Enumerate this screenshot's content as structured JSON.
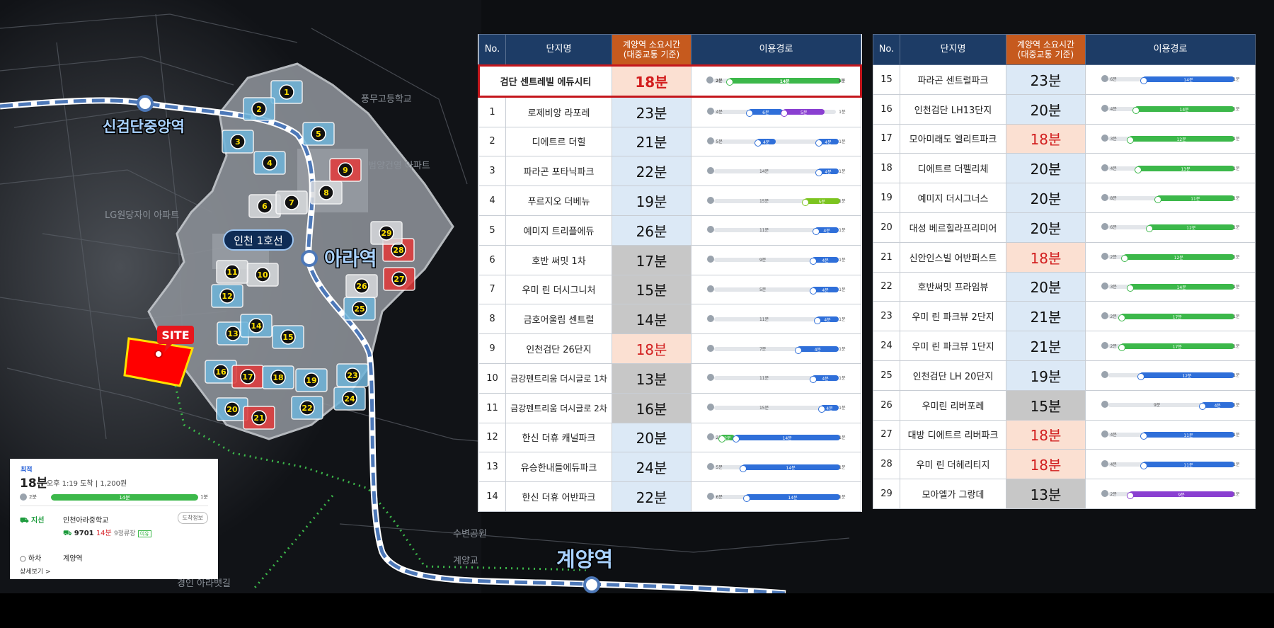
{
  "map": {
    "station_labels": {
      "sin_geomdan": "신검단중앙역",
      "ara": "아라역",
      "gyeyang": "계양역"
    },
    "line_label": "인천 1호선",
    "site_label": "SITE",
    "bg_labels": [
      "LG원당자이 아파트",
      "풍무고등학교",
      "범양건영 아파트",
      "수변공원",
      "계양교",
      "경인 아라뱃길"
    ],
    "markers": [
      {
        "n": "1",
        "c": "blue"
      },
      {
        "n": "2",
        "c": "blue"
      },
      {
        "n": "3",
        "c": "blue"
      },
      {
        "n": "4",
        "c": "blue"
      },
      {
        "n": "5",
        "c": "blue"
      },
      {
        "n": "6",
        "c": "gray"
      },
      {
        "n": "7",
        "c": "gray"
      },
      {
        "n": "8",
        "c": "gray"
      },
      {
        "n": "9",
        "c": "red"
      },
      {
        "n": "10",
        "c": "gray"
      },
      {
        "n": "11",
        "c": "gray"
      },
      {
        "n": "12",
        "c": "blue"
      },
      {
        "n": "13",
        "c": "blue"
      },
      {
        "n": "14",
        "c": "blue"
      },
      {
        "n": "15",
        "c": "blue"
      },
      {
        "n": "16",
        "c": "blue"
      },
      {
        "n": "17",
        "c": "red"
      },
      {
        "n": "18",
        "c": "blue"
      },
      {
        "n": "19",
        "c": "blue"
      },
      {
        "n": "20",
        "c": "blue"
      },
      {
        "n": "21",
        "c": "red"
      },
      {
        "n": "22",
        "c": "blue"
      },
      {
        "n": "23",
        "c": "blue"
      },
      {
        "n": "24",
        "c": "blue"
      },
      {
        "n": "25",
        "c": "blue"
      },
      {
        "n": "26",
        "c": "gray"
      },
      {
        "n": "27",
        "c": "red"
      },
      {
        "n": "28",
        "c": "red"
      },
      {
        "n": "29",
        "c": "gray"
      }
    ]
  },
  "info_card": {
    "label": "최적",
    "time": "18분",
    "arrival": "오후 1:19 도착  |  1,200원",
    "walk_start": "2분",
    "bus_minutes": "14분",
    "walk_end": "1분",
    "board_label": "⛟ 지선",
    "board_stop": "인천아라중학교",
    "button": "도착정보",
    "bus_no": "9701",
    "bus_time": "14분",
    "bus_stops": "9정류장",
    "bus_tag": "여유",
    "alight_label": "○ 하차",
    "alight_stop": "계양역",
    "more": "상세보기 >"
  },
  "headers": {
    "no": "No.",
    "name": "단지명",
    "time": "계양역 소요시간\n(대중교통 기준)",
    "route": "이용경로"
  },
  "colors": {
    "green": "#3cb84a",
    "blue": "#2f6fd9",
    "purple": "#8a3fd1",
    "lime": "#7cc41f",
    "walk": "#9aa3ad"
  },
  "table_left": [
    {
      "no": "",
      "name": "검단 센트레빌 에듀시티",
      "time": "18분",
      "bg": "peach",
      "featured": true,
      "route": {
        "walk": "2분",
        "segs": [
          {
            "c": "green",
            "s": 0.16,
            "e": 0.97,
            "l": "14분"
          }
        ],
        "end": "1분"
      }
    },
    {
      "no": "1",
      "name": "로제비앙 라포레",
      "time": "23분",
      "bg": "blue",
      "route": {
        "walk": "4분",
        "segs": [
          {
            "c": "blue",
            "s": 0.3,
            "e": 0.55,
            "l": "6분"
          },
          {
            "c": "purple",
            "s": 0.55,
            "e": 0.85,
            "l": "5분"
          }
        ],
        "end": "1분"
      }
    },
    {
      "no": "2",
      "name": "디에트르 더힐",
      "time": "21분",
      "bg": "blue",
      "route": {
        "walk": "5분",
        "segs": [
          {
            "c": "blue",
            "s": 0.36,
            "e": 0.5,
            "l": "4분"
          },
          {
            "c": "blue",
            "s": 0.8,
            "e": 0.95,
            "l": "4분"
          }
        ],
        "end": "1분",
        "mid": "4분"
      }
    },
    {
      "no": "3",
      "name": "파라곤 포타닉파크",
      "time": "22분",
      "bg": "blue",
      "route": {
        "walk": "",
        "segs": [
          {
            "c": "blue",
            "s": 0.8,
            "e": 0.95,
            "l": "4분"
          }
        ],
        "end": "1분",
        "mid": "14분"
      }
    },
    {
      "no": "4",
      "name": "푸르지오 더베뉴",
      "time": "19분",
      "bg": "blue",
      "route": {
        "walk": "",
        "segs": [
          {
            "c": "lime",
            "s": 0.7,
            "e": 0.96,
            "l": "5분"
          }
        ],
        "end": "1분",
        "mid": "15분"
      }
    },
    {
      "no": "5",
      "name": "예미지 트리플에듀",
      "time": "26분",
      "bg": "blue",
      "route": {
        "walk": "",
        "segs": [
          {
            "c": "blue",
            "s": 0.78,
            "e": 0.95,
            "l": "4분"
          }
        ],
        "end": "1분",
        "mid": "11분"
      }
    },
    {
      "no": "6",
      "name": "호반 써밋 1차",
      "time": "17분",
      "bg": "gray",
      "route": {
        "walk": "",
        "segs": [
          {
            "c": "blue",
            "s": 0.76,
            "e": 0.95,
            "l": "4분"
          }
        ],
        "end": "1분",
        "mid": "9분"
      }
    },
    {
      "no": "7",
      "name": "우미 린 더시그니처",
      "time": "15분",
      "bg": "gray",
      "route": {
        "walk": "",
        "segs": [
          {
            "c": "blue",
            "s": 0.76,
            "e": 0.95,
            "l": "4분"
          }
        ],
        "end": "1분",
        "mid": "5분"
      }
    },
    {
      "no": "8",
      "name": "금호어울림 센트럴",
      "time": "14분",
      "bg": "gray",
      "route": {
        "walk": "",
        "segs": [
          {
            "c": "blue",
            "s": 0.79,
            "e": 0.95,
            "l": "4분"
          }
        ],
        "end": "1분",
        "mid": "11분"
      }
    },
    {
      "no": "9",
      "name": "인천검단 26단지",
      "time": "18분",
      "bg": "peach",
      "route": {
        "walk": "",
        "segs": [
          {
            "c": "blue",
            "s": 0.65,
            "e": 0.95,
            "l": "4분"
          }
        ],
        "end": "1분",
        "mid": "7분"
      }
    },
    {
      "no": "10",
      "name": "금강펜트리움 더시글로 1차",
      "time": "13분",
      "bg": "gray",
      "route": {
        "walk": "",
        "segs": [
          {
            "c": "blue",
            "s": 0.76,
            "e": 0.95,
            "l": "4분"
          }
        ],
        "end": "1분",
        "mid": "11분"
      }
    },
    {
      "no": "11",
      "name": "금강펜트리움 더시글로 2차",
      "time": "16분",
      "bg": "gray",
      "route": {
        "walk": "",
        "segs": [
          {
            "c": "blue",
            "s": 0.82,
            "e": 0.95,
            "l": "4분"
          }
        ],
        "end": "1분",
        "mid": "15분"
      }
    },
    {
      "no": "12",
      "name": "한신 더휴 캐널파크",
      "time": "20분",
      "bg": "blue",
      "route": {
        "walk": "2분",
        "segs": [
          {
            "c": "green",
            "s": 0.1,
            "e": 0.2,
            "l": "2분"
          },
          {
            "c": "blue",
            "s": 0.2,
            "e": 0.96,
            "l": "14분"
          }
        ],
        "end": "1분"
      }
    },
    {
      "no": "13",
      "name": "유승한내들에듀파크",
      "time": "24분",
      "bg": "blue",
      "route": {
        "walk": "5분",
        "segs": [
          {
            "c": "blue",
            "s": 0.25,
            "e": 0.96,
            "l": "14분"
          }
        ],
        "end": "1분"
      }
    },
    {
      "no": "14",
      "name": "한신 더휴 어반파크",
      "time": "22분",
      "bg": "blue",
      "route": {
        "walk": "6분",
        "segs": [
          {
            "c": "blue",
            "s": 0.28,
            "e": 0.96,
            "l": "14분"
          }
        ],
        "end": "1분"
      }
    }
  ],
  "table_right": [
    {
      "no": "15",
      "name": "파라곤 센트럴파크",
      "time": "23분",
      "bg": "blue",
      "route": {
        "walk": "6분",
        "segs": [
          {
            "c": "blue",
            "s": 0.3,
            "e": 0.96,
            "l": "14분"
          }
        ],
        "end": "1분"
      }
    },
    {
      "no": "16",
      "name": "인천검단 LH13단지",
      "time": "20분",
      "bg": "blue",
      "route": {
        "walk": "4분",
        "segs": [
          {
            "c": "green",
            "s": 0.24,
            "e": 0.96,
            "l": "14분"
          }
        ],
        "end": "1분"
      }
    },
    {
      "no": "17",
      "name": "모아미래도 엘리트파크",
      "time": "18분",
      "bg": "peach",
      "route": {
        "walk": "3분",
        "segs": [
          {
            "c": "green",
            "s": 0.2,
            "e": 0.96,
            "l": "12분"
          }
        ],
        "end": "1분"
      }
    },
    {
      "no": "18",
      "name": "디에트르 더펠리체",
      "time": "20분",
      "bg": "blue",
      "route": {
        "walk": "4분",
        "segs": [
          {
            "c": "green",
            "s": 0.26,
            "e": 0.96,
            "l": "13분"
          }
        ],
        "end": "1분"
      }
    },
    {
      "no": "19",
      "name": "예미지 더시그너스",
      "time": "20분",
      "bg": "blue",
      "route": {
        "walk": "8분",
        "segs": [
          {
            "c": "green",
            "s": 0.4,
            "e": 0.96,
            "l": "11분"
          }
        ],
        "end": "1분"
      }
    },
    {
      "no": "20",
      "name": "대성 베르힐라프리미어",
      "time": "20분",
      "bg": "blue",
      "route": {
        "walk": "6분",
        "segs": [
          {
            "c": "green",
            "s": 0.34,
            "e": 0.96,
            "l": "12분"
          }
        ],
        "end": "1분"
      }
    },
    {
      "no": "21",
      "name": "신안인스빌 어반퍼스트",
      "time": "18분",
      "bg": "peach",
      "route": {
        "walk": "2분",
        "segs": [
          {
            "c": "green",
            "s": 0.16,
            "e": 0.96,
            "l": "12분"
          }
        ],
        "end": "1분"
      }
    },
    {
      "no": "22",
      "name": "호반써밋 프라임뷰",
      "time": "20분",
      "bg": "blue",
      "route": {
        "walk": "3분",
        "segs": [
          {
            "c": "green",
            "s": 0.2,
            "e": 0.96,
            "l": "14분"
          }
        ],
        "end": "1분"
      }
    },
    {
      "no": "23",
      "name": "우미 린 파크뷰 2단지",
      "time": "21분",
      "bg": "blue",
      "route": {
        "walk": "2분",
        "segs": [
          {
            "c": "green",
            "s": 0.14,
            "e": 0.96,
            "l": "17분"
          }
        ],
        "end": "1분"
      }
    },
    {
      "no": "24",
      "name": "우미 린 파크뷰 1단지",
      "time": "21분",
      "bg": "blue",
      "route": {
        "walk": "2분",
        "segs": [
          {
            "c": "green",
            "s": 0.14,
            "e": 0.96,
            "l": "17분"
          }
        ],
        "end": "1분"
      }
    },
    {
      "no": "25",
      "name": "인천검단 LH 20단지",
      "time": "19분",
      "bg": "blue",
      "route": {
        "walk": "",
        "segs": [
          {
            "c": "blue",
            "s": 0.28,
            "e": 0.96,
            "l": "12분"
          }
        ],
        "end": "1분"
      }
    },
    {
      "no": "26",
      "name": "우미린 리버포레",
      "time": "15분",
      "bg": "gray",
      "route": {
        "walk": "",
        "segs": [
          {
            "c": "blue",
            "s": 0.72,
            "e": 0.96,
            "l": "4분"
          }
        ],
        "end": "1분",
        "mid": "9분"
      }
    },
    {
      "no": "27",
      "name": "대방 디에트르 리버파크",
      "time": "18분",
      "bg": "peach",
      "route": {
        "walk": "4분",
        "segs": [
          {
            "c": "blue",
            "s": 0.3,
            "e": 0.96,
            "l": "11분"
          }
        ],
        "end": "1분"
      }
    },
    {
      "no": "28",
      "name": "우미 린 더헤리티지",
      "time": "18분",
      "bg": "peach",
      "route": {
        "walk": "4분",
        "segs": [
          {
            "c": "blue",
            "s": 0.3,
            "e": 0.96,
            "l": "11분"
          }
        ],
        "end": "1분"
      }
    },
    {
      "no": "29",
      "name": "모아엘가 그랑데",
      "time": "13분",
      "bg": "gray",
      "route": {
        "walk": "2분",
        "segs": [
          {
            "c": "purple",
            "s": 0.2,
            "e": 0.96,
            "l": "9분"
          }
        ],
        "end": "1분"
      }
    }
  ]
}
